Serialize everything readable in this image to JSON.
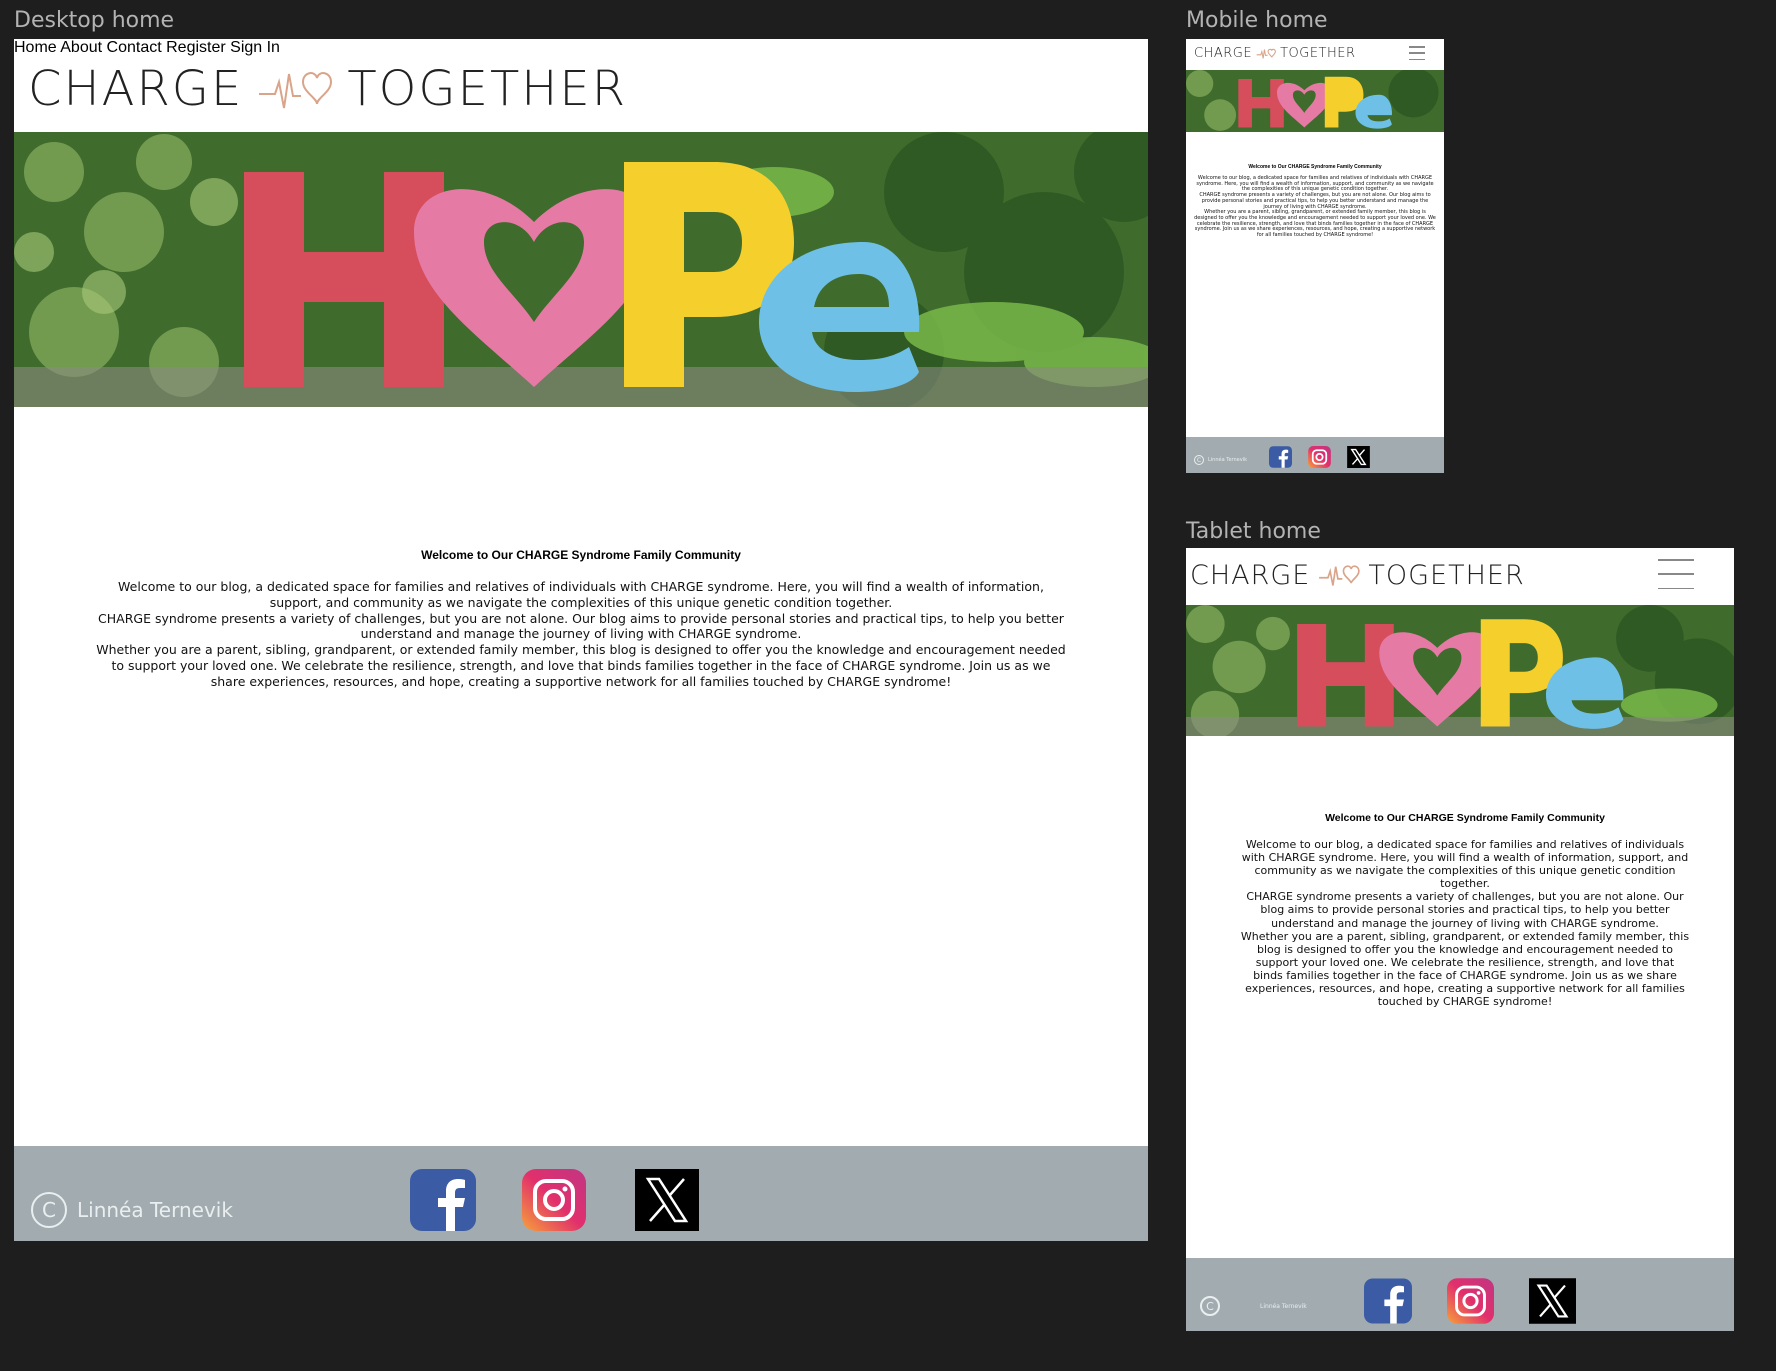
{
  "frames": {
    "desktop_label": "Desktop home",
    "mobile_label": "Mobile home",
    "tablet_label": "Tablet home"
  },
  "brand": {
    "word_left": "CHARGE",
    "word_right": "TOGETHER",
    "accent_color": "#d9a48a"
  },
  "nav": {
    "home": "Home",
    "about": "About",
    "contact": "Contact",
    "register": "Register",
    "sign_in": "Sign In"
  },
  "hero": {
    "letters": [
      "H",
      "P",
      "e"
    ],
    "colors": {
      "h": "#d64d5c",
      "heart": "#e57aa5",
      "p": "#f5cf2b",
      "e": "#6ec0e6"
    }
  },
  "content": {
    "title": "Welcome to Our CHARGE Syndrome Family Community",
    "p1": "Welcome to our blog, a dedicated space for families and relatives of individuals with CHARGE syndrome. Here, you will find a wealth of information, support, and community as we navigate the complexities of this unique genetic condition together.",
    "p2": "CHARGE syndrome presents a variety of challenges, but you are not alone. Our blog aims to provide personal stories and practical tips, to help you better understand and manage the journey of living with CHARGE syndrome.",
    "p3": "Whether you are a parent, sibling, grandparent, or extended family member, this blog is designed to offer you the knowledge and encouragement needed to support your loved one. We celebrate the resilience, strength, and love that binds families together in the face of CHARGE syndrome. Join us as we share experiences, resources, and hope, creating a supportive network for all families touched by CHARGE syndrome!"
  },
  "footer": {
    "copyright_symbol": "C",
    "author": "Linnéa Ternevik",
    "background": "#a2acb0",
    "icons": [
      "facebook-icon",
      "instagram-icon",
      "x-icon"
    ]
  }
}
